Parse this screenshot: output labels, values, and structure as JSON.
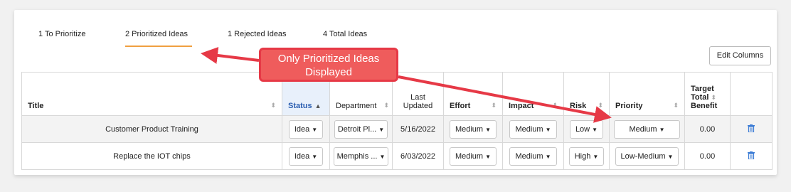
{
  "tabs": [
    {
      "label": "1 To Prioritize"
    },
    {
      "label": "2 Prioritized Ideas",
      "active": true
    },
    {
      "label": "1 Rejected Ideas"
    },
    {
      "label": "4 Total Ideas"
    }
  ],
  "toolbar": {
    "edit_columns_label": "Edit Columns"
  },
  "annotation": {
    "line1": "Only Prioritized Ideas",
    "line2": "Displayed",
    "color": "#e63946"
  },
  "table": {
    "headers": {
      "title": "Title",
      "status": "Status",
      "department": "Department",
      "last_updated_1": "Last",
      "last_updated_2": "Updated",
      "effort": "Effort",
      "impact": "Impact",
      "risk": "Risk",
      "priority": "Priority",
      "target_1": "Target",
      "target_2": "Total",
      "target_3": "Benefit"
    },
    "rows": [
      {
        "title": "Customer Product Training",
        "status": "Idea",
        "department": "Detroit Pl...",
        "last_updated": "5/16/2022",
        "effort": "Medium",
        "impact": "Medium",
        "risk": "Low",
        "priority": "Medium",
        "benefit": "0.00"
      },
      {
        "title": "Replace the IOT chips",
        "status": "Idea",
        "department": "Memphis ...",
        "last_updated": "6/03/2022",
        "effort": "Medium",
        "impact": "Medium",
        "risk": "High",
        "priority": "Low-Medium",
        "benefit": "0.00"
      }
    ]
  },
  "colors": {
    "accent_underline": "#f0a040",
    "sorted_header": "#e8f0fb",
    "trash": "#3a7bd5"
  }
}
